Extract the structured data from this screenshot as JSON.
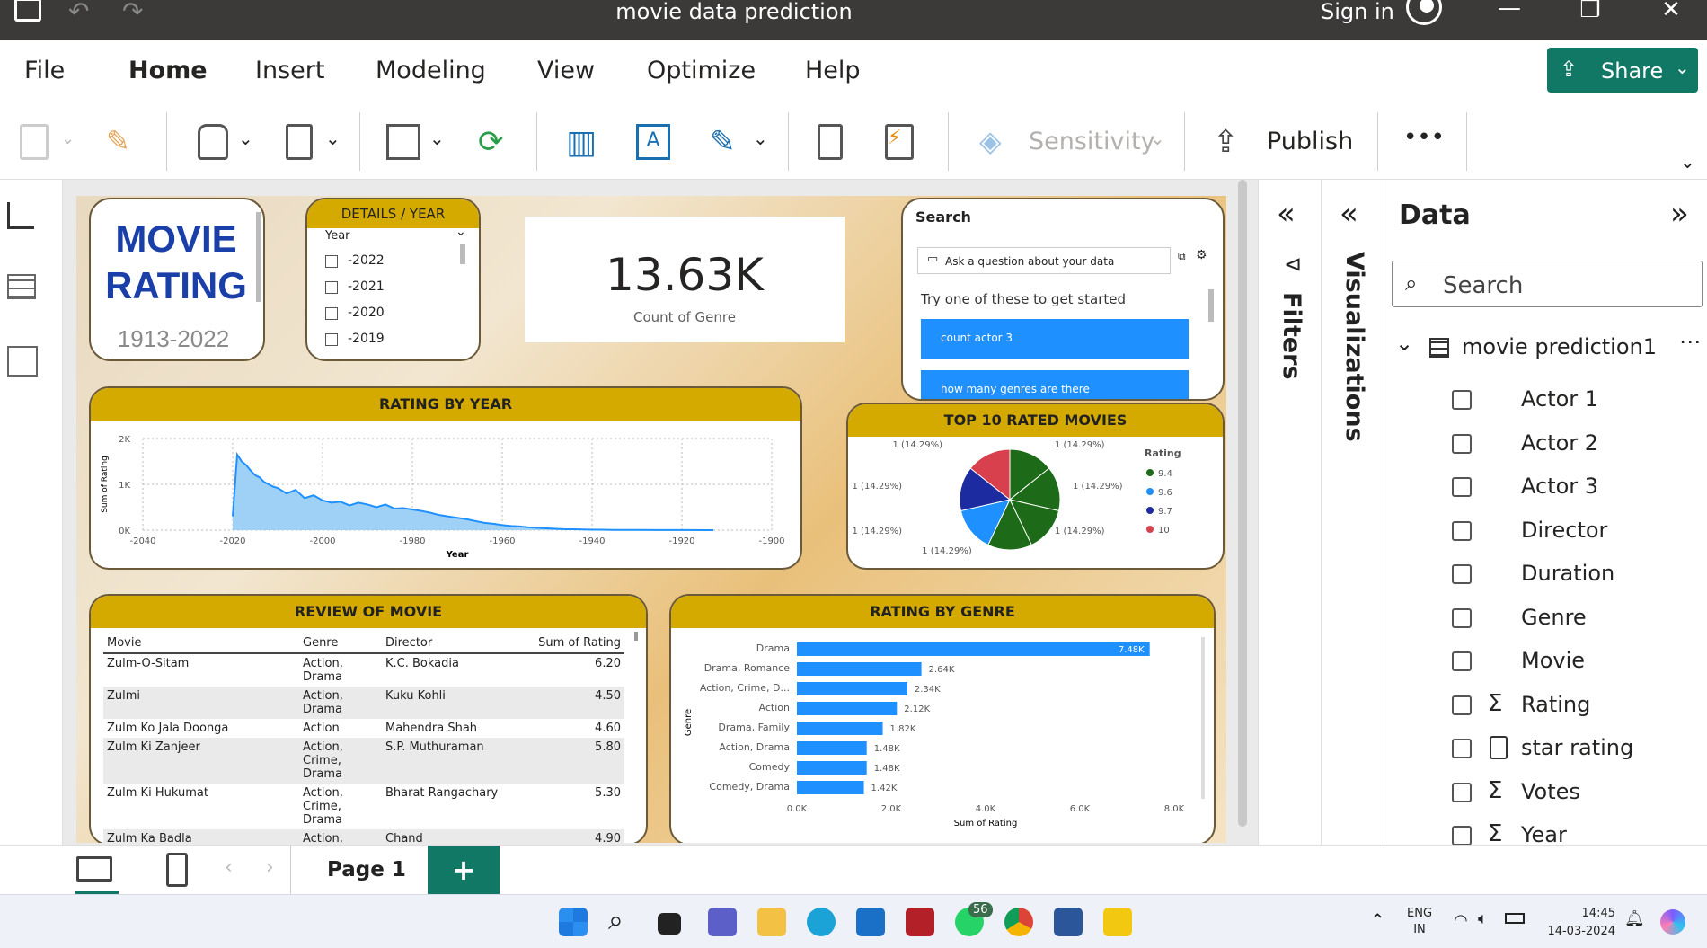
{
  "window": {
    "title": "movie data prediction",
    "sign_in": "Sign in"
  },
  "menu": [
    "File",
    "Home",
    "Insert",
    "Modeling",
    "View",
    "Optimize",
    "Help"
  ],
  "share_label": "Share",
  "ribbon": {
    "sensitivity": "Sensitivity",
    "publish": "Publish",
    "more": "•••"
  },
  "report": {
    "title_line1": "MOVIE",
    "title_line2": "RATING",
    "title_years": "1913-2022",
    "slicer": {
      "title": "DETAILS / YEAR",
      "field": "Year",
      "items": [
        "-2022",
        "-2021",
        "-2020",
        "-2019"
      ]
    },
    "kpi": {
      "value": "13.63K",
      "label": "Count of Genre"
    },
    "qa": {
      "title": "Search",
      "placeholder": "Ask a question about your data",
      "hint": "Try one of these to get started",
      "suggestions": [
        "count actor 3",
        "how many genres are there"
      ]
    },
    "rating_by_year": {
      "title": "RATING BY YEAR"
    },
    "top10": {
      "title": "TOP 10 RATED MOVIES"
    },
    "review": {
      "title": "REVIEW OF MOVIE"
    },
    "rating_by_genre": {
      "title": "RATING BY GENRE"
    }
  },
  "chart_data": [
    {
      "type": "area",
      "title": "RATING BY YEAR",
      "xlabel": "Year",
      "ylabel": "Sum of Rating",
      "x_ticks": [
        "-2040",
        "-2020",
        "-2000",
        "-1980",
        "-1960",
        "-1940",
        "-1920",
        "-1900"
      ],
      "y_ticks": [
        "0K",
        "1K",
        "2K"
      ],
      "ylim": [
        0,
        2000
      ],
      "xlim": [
        -2040,
        -1900
      ],
      "x": [
        -2020,
        -2019,
        -2018,
        -2017,
        -2016,
        -2015,
        -2014,
        -2013,
        -2012,
        -2011,
        -2010,
        -2008,
        -2006,
        -2004,
        -2002,
        -2000,
        -1998,
        -1996,
        -1994,
        -1992,
        -1990,
        -1988,
        -1986,
        -1984,
        -1982,
        -1980,
        -1978,
        -1976,
        -1974,
        -1972,
        -1970,
        -1968,
        -1966,
        -1964,
        -1962,
        -1960,
        -1958,
        -1956,
        -1954,
        -1952,
        -1950,
        -1948,
        -1946,
        -1944,
        -1942,
        -1940,
        -1938,
        -1935,
        -1930,
        -1925,
        -1920,
        -1913
      ],
      "values": [
        300,
        1650,
        1500,
        1420,
        1300,
        1200,
        1150,
        1050,
        1000,
        950,
        920,
        800,
        880,
        700,
        760,
        650,
        600,
        620,
        540,
        600,
        560,
        500,
        560,
        470,
        480,
        450,
        420,
        380,
        330,
        300,
        270,
        240,
        200,
        160,
        140,
        110,
        90,
        80,
        60,
        50,
        40,
        30,
        20,
        20,
        15,
        10,
        10,
        5,
        5,
        3,
        2,
        1
      ]
    },
    {
      "type": "pie",
      "title": "TOP 10 RATED MOVIES",
      "legend_title": "Rating",
      "legend": [
        "9.4",
        "9.6",
        "9.7",
        "10"
      ],
      "slices": [
        {
          "label": "1 (14.29%)",
          "value": 1,
          "rating": "9.4"
        },
        {
          "label": "1 (14.29%)",
          "value": 1,
          "rating": "9.4"
        },
        {
          "label": "1 (14.29%)",
          "value": 1,
          "rating": "9.4"
        },
        {
          "label": "1 (14.29%)",
          "value": 1,
          "rating": "9.4"
        },
        {
          "label": "1 (14.29%)",
          "value": 1,
          "rating": "9.6"
        },
        {
          "label": "1 (14.29%)",
          "value": 1,
          "rating": "9.7"
        },
        {
          "label": "1 (14.29%)",
          "value": 1,
          "rating": "10"
        }
      ]
    },
    {
      "type": "bar",
      "title": "RATING BY GENRE",
      "xlabel": "Sum of Rating",
      "ylabel": "Genre",
      "x_ticks": [
        "0.0K",
        "2.0K",
        "4.0K",
        "6.0K",
        "8.0K"
      ],
      "xlim": [
        0,
        8000
      ],
      "categories": [
        "Drama",
        "Drama, Romance",
        "Action, Crime, D...",
        "Action",
        "Drama, Family",
        "Action, Drama",
        "Comedy",
        "Comedy, Drama"
      ],
      "values": [
        7480,
        2640,
        2340,
        2120,
        1820,
        1480,
        1480,
        1420
      ],
      "labels": [
        "7.48K",
        "2.64K",
        "2.34K",
        "2.12K",
        "1.82K",
        "1.48K",
        "1.48K",
        "1.42K"
      ]
    },
    {
      "type": "table",
      "title": "REVIEW OF MOVIE",
      "columns": [
        "Movie",
        "Genre",
        "Director",
        "Sum of Rating"
      ],
      "rows": [
        [
          "Zulm-O-Sitam",
          "Action, Drama",
          "K.C. Bokadia",
          "6.20"
        ],
        [
          "Zulmi",
          "Action, Drama",
          "Kuku Kohli",
          "4.50"
        ],
        [
          "Zulm Ko Jala Doonga",
          "Action",
          "Mahendra Shah",
          "4.60"
        ],
        [
          "Zulm Ki Zanjeer",
          "Action, Crime, Drama",
          "S.P. Muthuraman",
          "5.80"
        ],
        [
          "Zulm Ki Hukumat",
          "Action, Crime, Drama",
          "Bharat Rangachary",
          "5.30"
        ],
        [
          "Zulm Ka Badla",
          "Action,",
          "Chand",
          "4.90"
        ]
      ]
    }
  ],
  "panes": {
    "filters": "Filters",
    "visualizations": "Visualizations",
    "data": "Data",
    "search_placeholder": "Search",
    "table_name": "movie prediction1",
    "fields": [
      {
        "name": "Actor 1",
        "icon": ""
      },
      {
        "name": "Actor 2",
        "icon": ""
      },
      {
        "name": "Actor 3",
        "icon": ""
      },
      {
        "name": "Director",
        "icon": ""
      },
      {
        "name": "Duration",
        "icon": ""
      },
      {
        "name": "Genre",
        "icon": ""
      },
      {
        "name": "Movie",
        "icon": ""
      },
      {
        "name": "Rating",
        "icon": "Σ"
      },
      {
        "name": "star rating",
        "icon": "calc"
      },
      {
        "name": "Votes",
        "icon": "Σ"
      },
      {
        "name": "Year",
        "icon": "Σ"
      }
    ]
  },
  "pagebar": {
    "page": "Page 1",
    "add": "+"
  },
  "taskbar": {
    "lang1": "ENG",
    "lang2": "IN",
    "time": "14:45",
    "date": "14-03-2024",
    "badge": "56"
  }
}
